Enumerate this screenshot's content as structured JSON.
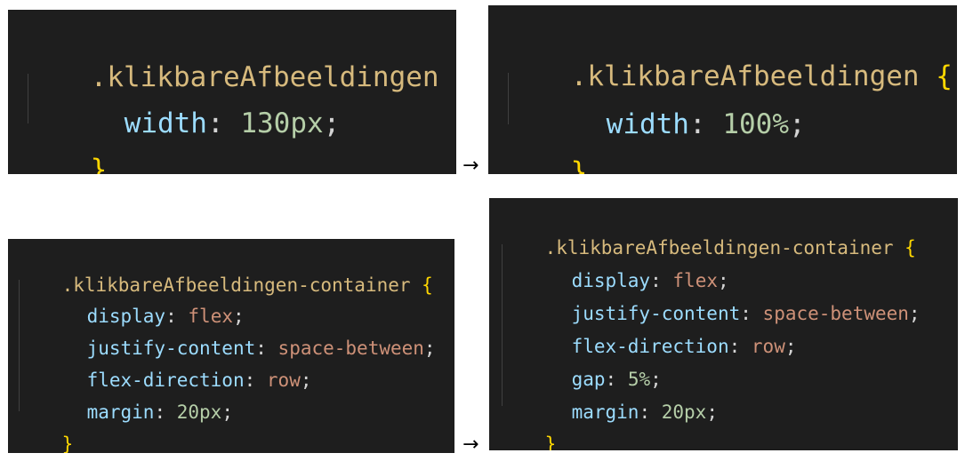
{
  "panels": {
    "top_left": {
      "selector": ".klikbareAfbeeldingen",
      "open_brace": "{",
      "close_brace": "}",
      "decls": [
        {
          "prop": "width",
          "colon": ":",
          "value": "130px",
          "semi": ";"
        }
      ]
    },
    "top_right": {
      "selector": ".klikbareAfbeeldingen",
      "open_brace": "{",
      "close_brace": "}",
      "decls": [
        {
          "prop": "width",
          "colon": ":",
          "value": "100%",
          "semi": ";"
        }
      ]
    },
    "bottom_left": {
      "selector": ".klikbareAfbeeldingen-container",
      "open_brace": "{",
      "close_brace": "}",
      "decls": [
        {
          "prop": "display",
          "colon": ":",
          "value": "flex",
          "semi": ";"
        },
        {
          "prop": "justify-content",
          "colon": ":",
          "value": "space-between",
          "semi": ";"
        },
        {
          "prop": "flex-direction",
          "colon": ":",
          "value": "row",
          "semi": ";"
        },
        {
          "prop": "margin",
          "colon": ":",
          "value": "20px",
          "semi": ";"
        }
      ]
    },
    "bottom_right": {
      "selector": ".klikbareAfbeeldingen-container",
      "open_brace": "{",
      "close_brace": "}",
      "decls": [
        {
          "prop": "display",
          "colon": ":",
          "value": "flex",
          "semi": ";"
        },
        {
          "prop": "justify-content",
          "colon": ":",
          "value": "space-between",
          "semi": ";"
        },
        {
          "prop": "flex-direction",
          "colon": ":",
          "value": "row",
          "semi": ";"
        },
        {
          "prop": "gap",
          "colon": ":",
          "value": "5%",
          "semi": ";"
        },
        {
          "prop": "margin",
          "colon": ":",
          "value": "20px",
          "semi": ";"
        }
      ]
    }
  },
  "arrows": {
    "top": "→",
    "bottom": "→"
  },
  "colors": {
    "background": "#1e1e1e",
    "selector": "#d7ba7d",
    "brace": "#ffd700",
    "property": "#9cdcfe",
    "keyword_value": "#ce9178",
    "numeric_value": "#b5cea8",
    "punctuation": "#d4d4d4"
  }
}
